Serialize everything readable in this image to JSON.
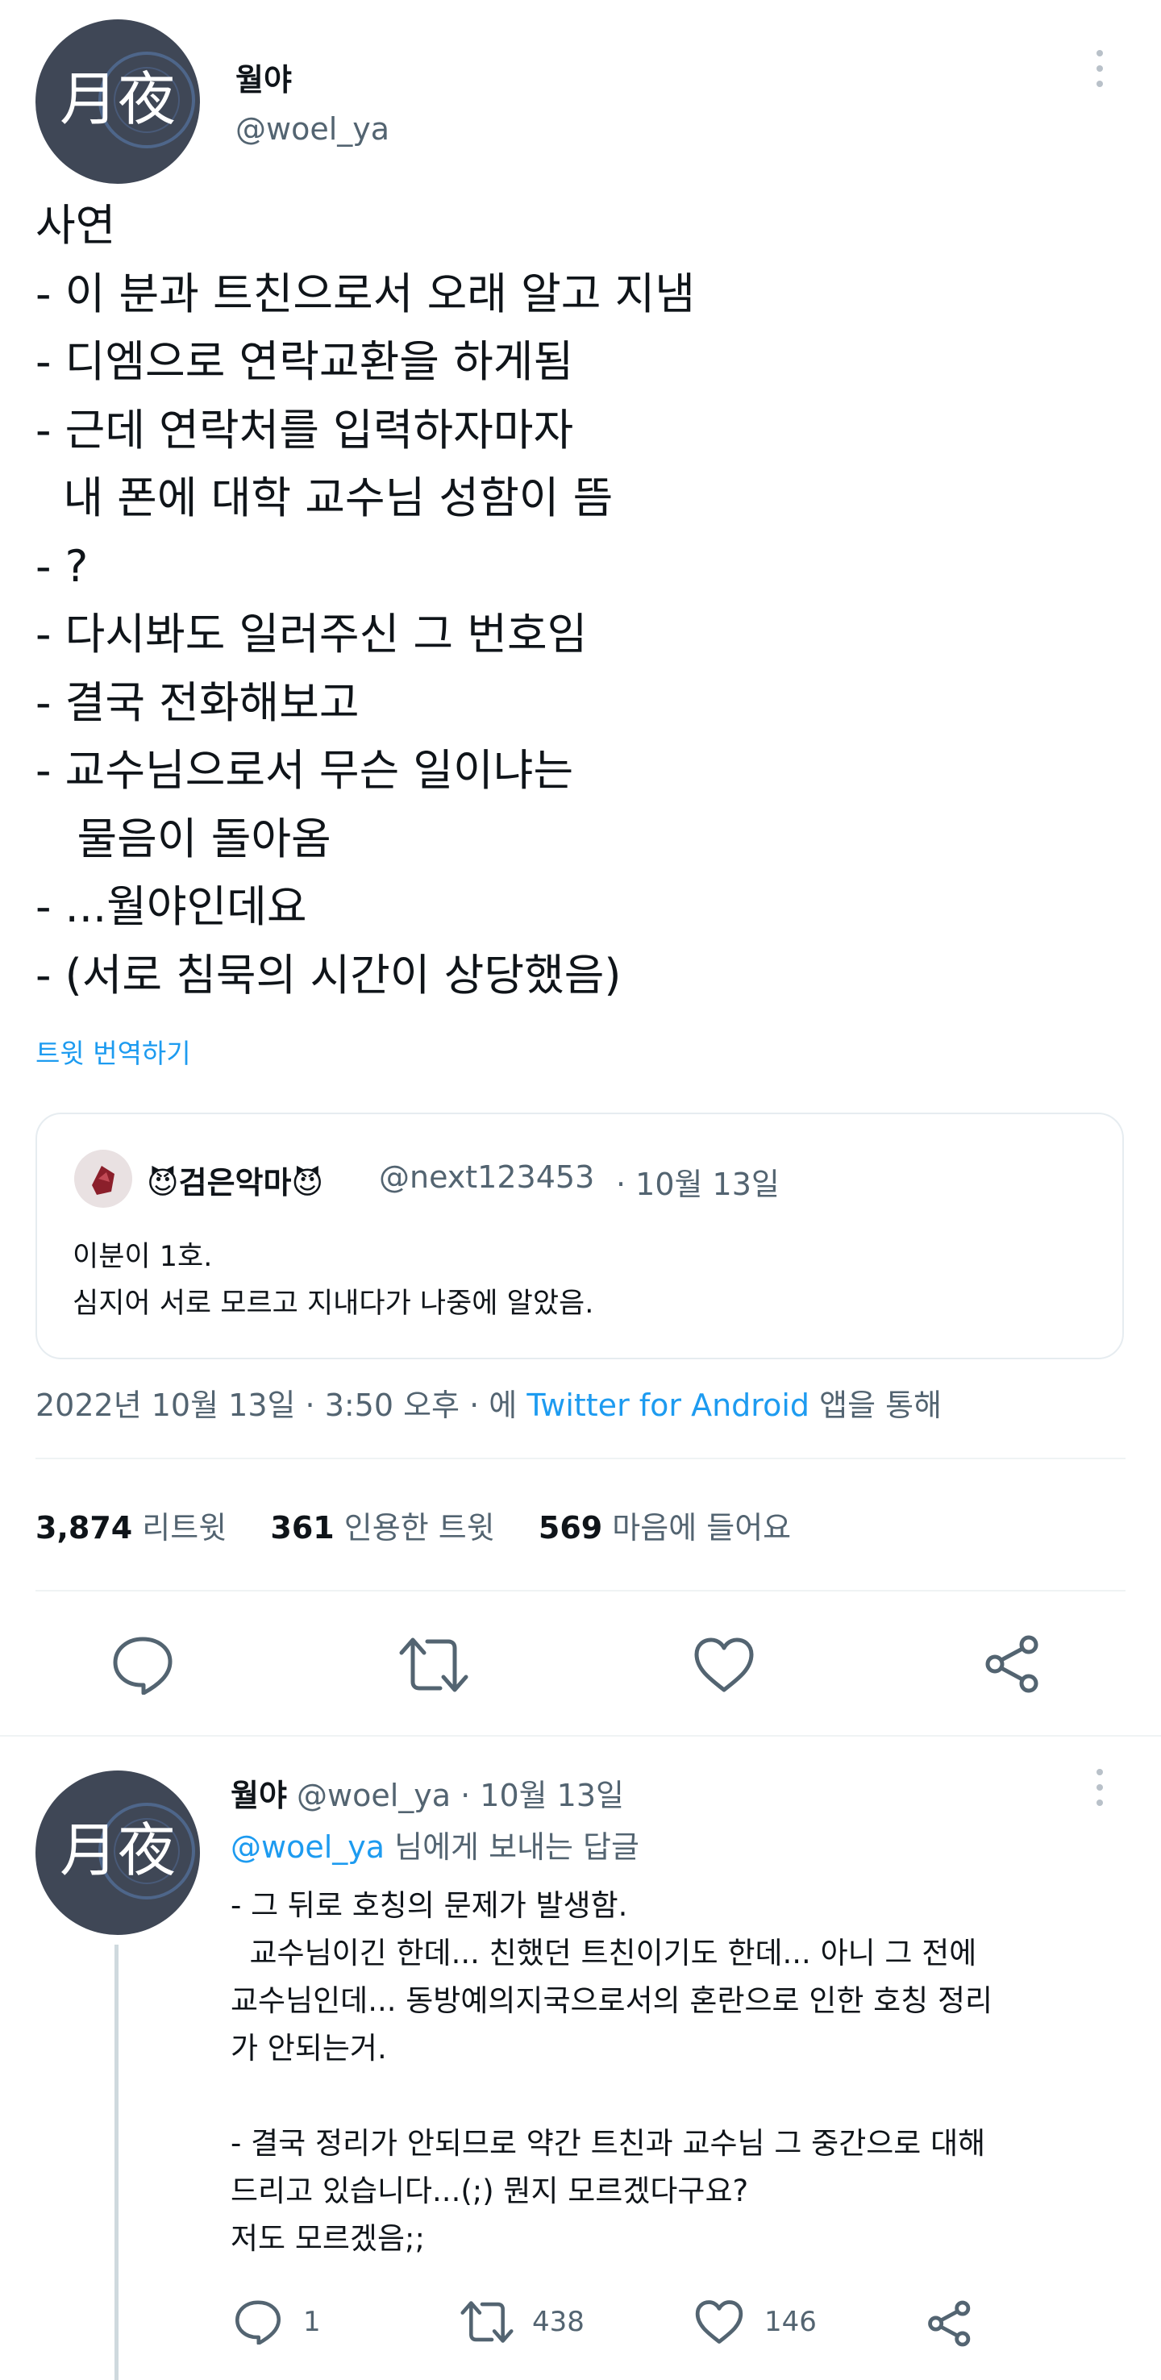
{
  "main_tweet": {
    "display_name": "월야",
    "handle": "@woel_ya",
    "avatar_text": "月夜",
    "body_lines": [
      "사연",
      "- 이 분과 트친으로서 오래 알고 지냄",
      "- 디엠으로 연락교환을 하게됨",
      "- 근데 연락처를 입력하자마자",
      "  내 폰에 대학 교수님 성함이 뜸",
      "- ?",
      "- 다시봐도 일러주신 그 번호임",
      "- 결국 전화해보고",
      "- 교수님으로서 무슨 일이냐는",
      "   물음이 돌아옴",
      "- ...월야인데요",
      "- (서로 침묵의 시간이 상당했음)"
    ],
    "translate_label": "트윗 번역하기",
    "quote": {
      "display_name": "😈검은악마😈",
      "handle": "@next123453",
      "date": "· 10월 13일",
      "lines": [
        "이분이 1호.",
        "심지어 서로 모르고 지내다가 나중에 알았음."
      ]
    },
    "timestamp": "2022년 10월 13일 · 3:50 오후 · 에",
    "source": "Twitter for Android",
    "source_suffix": "앱을 통해",
    "stats": {
      "retweets": "3,874",
      "retweets_label": "리트윗",
      "quotes": "361",
      "quotes_label": "인용한 트윗",
      "likes": "569",
      "likes_label": "마음에 들어요"
    }
  },
  "reply": {
    "display_name": "월야",
    "handle_date": "@woel_ya · 10월 13일",
    "replying_to": "@woel_ya",
    "replying_suffix": "님에게 보내는 답글",
    "lines": [
      "- 그 뒤로 호칭의 문제가 발생함.",
      "  교수님이긴 한데... 친했던 트친이기도 한데... 아니 그 전에",
      "교수님인데... 동방예의지국으로서의 혼란으로 인한 호칭 정리",
      "가 안되는거.",
      "",
      "- 결국 정리가 안되므로 약간 트친과 교수님 그 중간으로 대해",
      "드리고 있습니다...(;) 뭔지 모르겠다구요?",
      "저도 모르겠음;;"
    ],
    "reply_count": "1",
    "retweet_count": "438",
    "like_count": "146"
  },
  "icons": [
    "more-icon",
    "reply-icon",
    "retweet-icon",
    "like-icon",
    "share-icon"
  ],
  "colors": {
    "link": "#1d9bf0",
    "secondary": "#536471",
    "divider": "#eff3f4",
    "avatar_bg": "#3f4756"
  }
}
